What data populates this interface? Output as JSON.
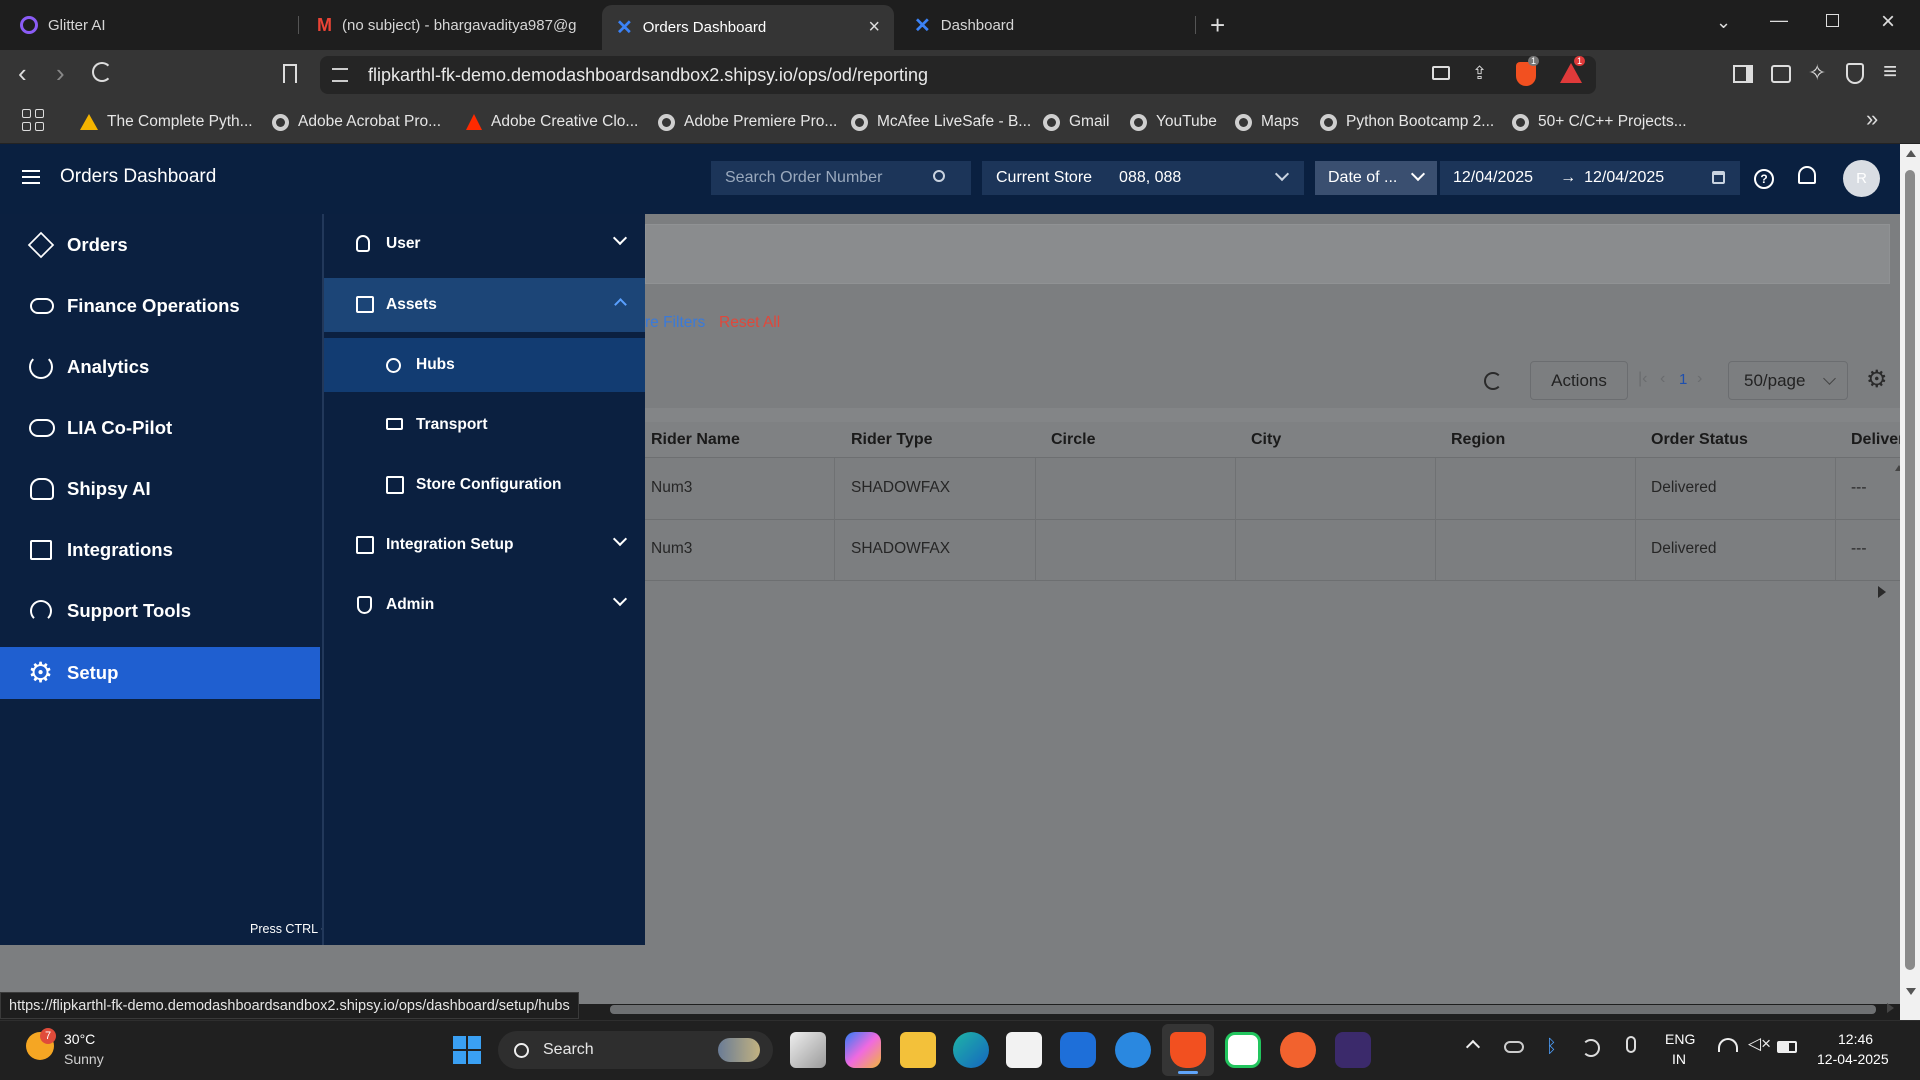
{
  "browser": {
    "tabs": [
      {
        "title": "Glitter AI",
        "icon": "glitter-icon",
        "active": false
      },
      {
        "title": "(no subject) - bhargavaditya987@g",
        "icon": "gmail-icon",
        "active": false
      },
      {
        "title": "Orders Dashboard",
        "icon": "shipsy-icon",
        "active": true
      },
      {
        "title": "Dashboard",
        "icon": "shipsy-icon",
        "active": false
      }
    ],
    "url": "flipkarthl-fk-demo.demodashboardsandbox2.shipsy.io/ops/od/reporting",
    "shield_badge": "1",
    "rewards_badge": "1",
    "bookmarks": [
      {
        "label": "The Complete Pyth...",
        "icon": "google-drive-icon"
      },
      {
        "label": "Adobe Acrobat Pro...",
        "icon": "globe-icon"
      },
      {
        "label": "Adobe Creative Clo...",
        "icon": "adobe-icon"
      },
      {
        "label": "Adobe Premiere Pro...",
        "icon": "globe-icon"
      },
      {
        "label": "McAfee LiveSafe - B...",
        "icon": "globe-icon"
      },
      {
        "label": "Gmail",
        "icon": "globe-icon"
      },
      {
        "label": "YouTube",
        "icon": "globe-icon"
      },
      {
        "label": "Maps",
        "icon": "globe-icon"
      },
      {
        "label": "Python Bootcamp 2...",
        "icon": "globe-icon"
      },
      {
        "label": "50+ C/C++ Projects...",
        "icon": "globe-icon"
      }
    ],
    "status_url": "https://flipkarthl-fk-demo.demodashboardsandbox2.shipsy.io/ops/dashboard/setup/hubs"
  },
  "header": {
    "title": "Orders Dashboard",
    "search_placeholder": "Search Order Number",
    "store_label": "Current Store",
    "store_value": "088, 088",
    "date_type": "Date of ...",
    "date_from": "12/04/2025",
    "date_arrow": "→",
    "date_to": "12/04/2025",
    "avatar_initial": "R"
  },
  "leftnav": {
    "items": [
      {
        "label": "Orders",
        "icon": "box-icon",
        "active": false
      },
      {
        "label": "Finance Operations",
        "icon": "money-icon",
        "active": false
      },
      {
        "label": "Analytics",
        "icon": "pie-chart-icon",
        "active": false
      },
      {
        "label": "LIA Co-Pilot",
        "icon": "copilot-icon",
        "active": false
      },
      {
        "label": "Shipsy AI",
        "icon": "ai-brain-icon",
        "active": false
      },
      {
        "label": "Integrations",
        "icon": "integrations-icon",
        "active": false
      },
      {
        "label": "Support Tools",
        "icon": "headset-icon",
        "active": false
      },
      {
        "label": "Setup",
        "icon": "gear-icon",
        "active": true
      }
    ],
    "search_hint": "Press CTRL + K to search"
  },
  "subnav": {
    "items": [
      {
        "label": "User",
        "icon": "user-icon",
        "expandable": true,
        "expanded": false,
        "level": 1
      },
      {
        "label": "Assets",
        "icon": "assets-icon",
        "expandable": true,
        "expanded": true,
        "level": 1
      },
      {
        "label": "Hubs",
        "icon": "globe-icon",
        "expandable": false,
        "level": 2,
        "active": true
      },
      {
        "label": "Transport",
        "icon": "truck-icon",
        "expandable": false,
        "level": 2
      },
      {
        "label": "Store Configuration",
        "icon": "store-config-icon",
        "expandable": false,
        "level": 2
      },
      {
        "label": "Integration Setup",
        "icon": "integration-setup-icon",
        "expandable": true,
        "expanded": false,
        "level": 1
      },
      {
        "label": "Admin",
        "icon": "admin-shield-icon",
        "expandable": true,
        "expanded": false,
        "level": 1
      }
    ]
  },
  "filters": {
    "more_filters": "re Filters",
    "reset_all": "Reset All"
  },
  "table_toolbar": {
    "actions": "Actions",
    "page": "1",
    "page_size": "50/page"
  },
  "table": {
    "columns": [
      "Rider Name",
      "Rider Type",
      "Circle",
      "City",
      "Region",
      "Order Status",
      "Deliver"
    ],
    "rows": [
      [
        "Num3",
        "SHADOWFAX",
        "",
        "",
        "",
        "Delivered",
        "---"
      ],
      [
        "Num3",
        "SHADOWFAX",
        "",
        "",
        "",
        "Delivered",
        "---"
      ]
    ]
  },
  "taskbar": {
    "weather_temp": "30°C",
    "weather_desc": "Sunny",
    "weather_badge": "7",
    "search_label": "Search",
    "language": "ENG",
    "region": "IN",
    "time": "12:46",
    "date": "12-04-2025"
  },
  "colors": {
    "nav_bg": "#0b2040",
    "active_blue": "#1f5fd0",
    "reset_red": "#e0483b",
    "link_blue": "#3a7ad9"
  }
}
